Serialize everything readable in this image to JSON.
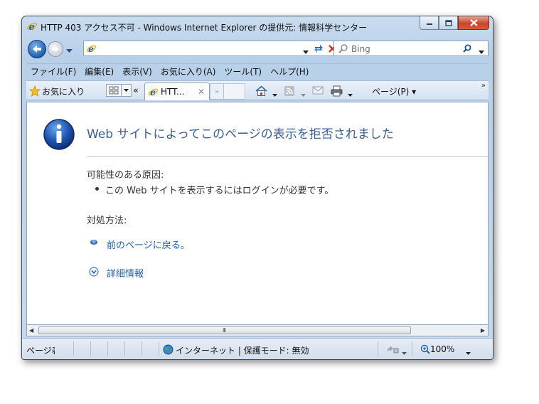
{
  "window": {
    "title": "HTTP 403 アクセス不可 - Windows Internet Explorer の提供元:  情報科学センター"
  },
  "address_bar": {
    "url": "",
    "search_placeholder": "Bing"
  },
  "menu": {
    "items": [
      "ファイル(F)",
      "編集(E)",
      "表示(V)",
      "お気に入り(A)",
      "ツール(T)",
      "ヘルプ(H)"
    ]
  },
  "favorites_bar": {
    "favorites_label": "お気に入り",
    "tab_scroll": "«",
    "tab_label": "HTT...",
    "tab_close": "✕",
    "tab_more": "»",
    "page_menu": "ページ(P) ▾",
    "overflow": "»"
  },
  "content": {
    "heading": "Web サイトによってこのページの表示を拒否されました",
    "cause_title": "可能性のある原因:",
    "cause_item": "この Web サイトを表示するにはログインが必要です。",
    "action_title": "対処方法:",
    "back_link": "前のページに戻る。",
    "more_info_link": "詳細情報"
  },
  "status_bar": {
    "status_text": "ページ表示中",
    "zone": "インターネット | 保護モード: 無効",
    "zoom": "100%"
  },
  "scrollbar": {
    "grip": "III"
  },
  "colors": {
    "heading": "#385f96",
    "link": "#1e5fae",
    "close_button": "#c9452b"
  }
}
